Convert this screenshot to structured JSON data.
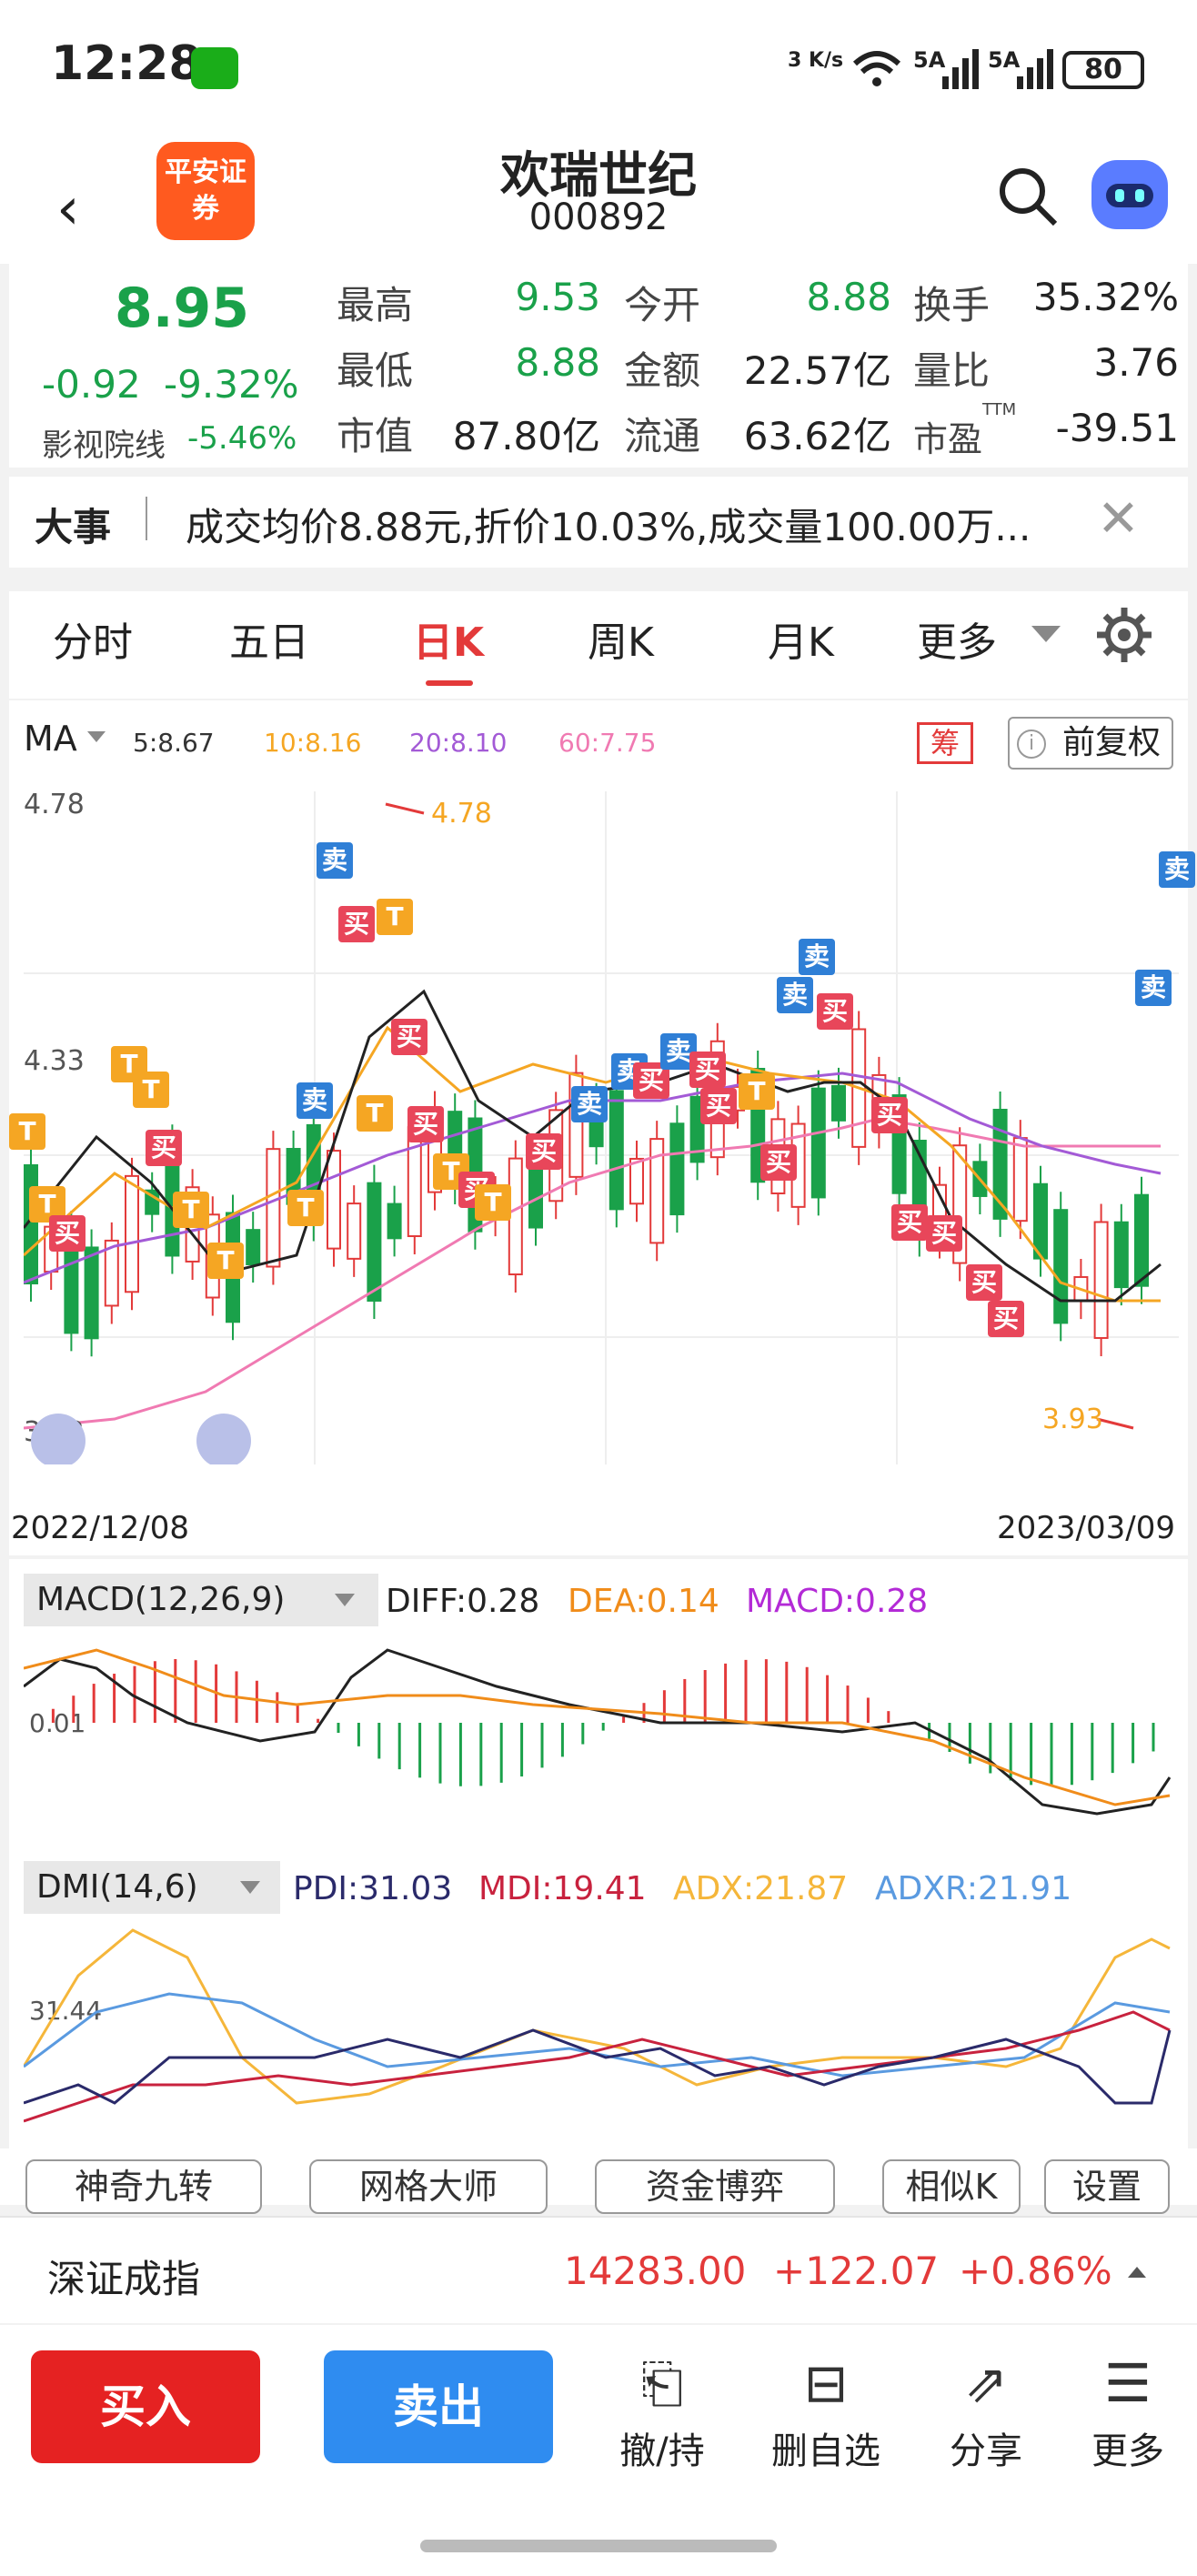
{
  "status_bar": {
    "time": "12:28",
    "speed": "3 K/s",
    "net1": "5A",
    "net2": "5A",
    "battery": "80"
  },
  "header": {
    "title": "欢瑞世纪",
    "code": "000892",
    "logo_text": "平安证券"
  },
  "quote": {
    "price": "8.95",
    "change": "-0.92",
    "change_pct": "-9.32%",
    "sector_name": "影视院线",
    "sector_pct": "-5.46%",
    "grid": [
      {
        "label": "最高",
        "value": "9.53",
        "label2": "今开",
        "value2": "8.88",
        "label3": "换手",
        "value3": "35.32%"
      },
      {
        "label": "最低",
        "value": "8.88",
        "label2": "金额",
        "value2": "22.57亿",
        "label3": "量比",
        "value3": "3.76"
      },
      {
        "label": "市值",
        "value": "87.80亿",
        "label2": "流通",
        "value2": "63.62亿",
        "label3": "市盈",
        "label3_sup": "TTM",
        "value3": "-39.51"
      }
    ]
  },
  "news": {
    "tag": "大事",
    "text": "成交均价8.88元,折价10.03%,成交量100.00万..."
  },
  "tabs": {
    "items": [
      "分时",
      "五日",
      "日K",
      "周K",
      "月K",
      "更多"
    ],
    "active": "日K"
  },
  "ma": {
    "label": "MA",
    "values": [
      {
        "text": "5:8.67",
        "color": "#333333"
      },
      {
        "text": "10:8.16",
        "color": "#f5a623"
      },
      {
        "text": "20:8.10",
        "color": "#a35ad6"
      },
      {
        "text": "60:7.75",
        "color": "#f07ab2"
      }
    ],
    "chou": "筹",
    "fuquan": "前复权"
  },
  "chart_data": {
    "type": "candlestick",
    "x_start": "2022/12/08",
    "x_end": "2023/03/09",
    "y_labels": [
      "4.78",
      "4.33",
      "3.92"
    ],
    "high_marker": "4.78",
    "low_marker": "3.93",
    "series_colors": {
      "ma5": "#333333",
      "ma10": "#f5a623",
      "ma20": "#a35ad6",
      "ma60": "#f07ab2"
    }
  },
  "macd": {
    "label": "MACD(12,26,9)",
    "diff": "DIFF:0.28",
    "dea": "DEA:0.14",
    "macd": "MACD:0.28",
    "zero_label": "0.01"
  },
  "dmi": {
    "label": "DMI(14,6)",
    "pdi": "PDI:31.03",
    "mdi": "MDI:19.41",
    "adx": "ADX:21.87",
    "adxr": "ADXR:21.91",
    "level_label": "31.44"
  },
  "tools": [
    "神奇九转",
    "网格大师",
    "资金博弈",
    "相似K",
    "设置"
  ],
  "index": {
    "name": "深证成指",
    "value": "14283.00",
    "change": "+122.07",
    "pct": "+0.86%"
  },
  "bottom": {
    "buy": "买入",
    "sell": "卖出",
    "icons": [
      "撤/持",
      "删自选",
      "分享",
      "更多"
    ]
  }
}
